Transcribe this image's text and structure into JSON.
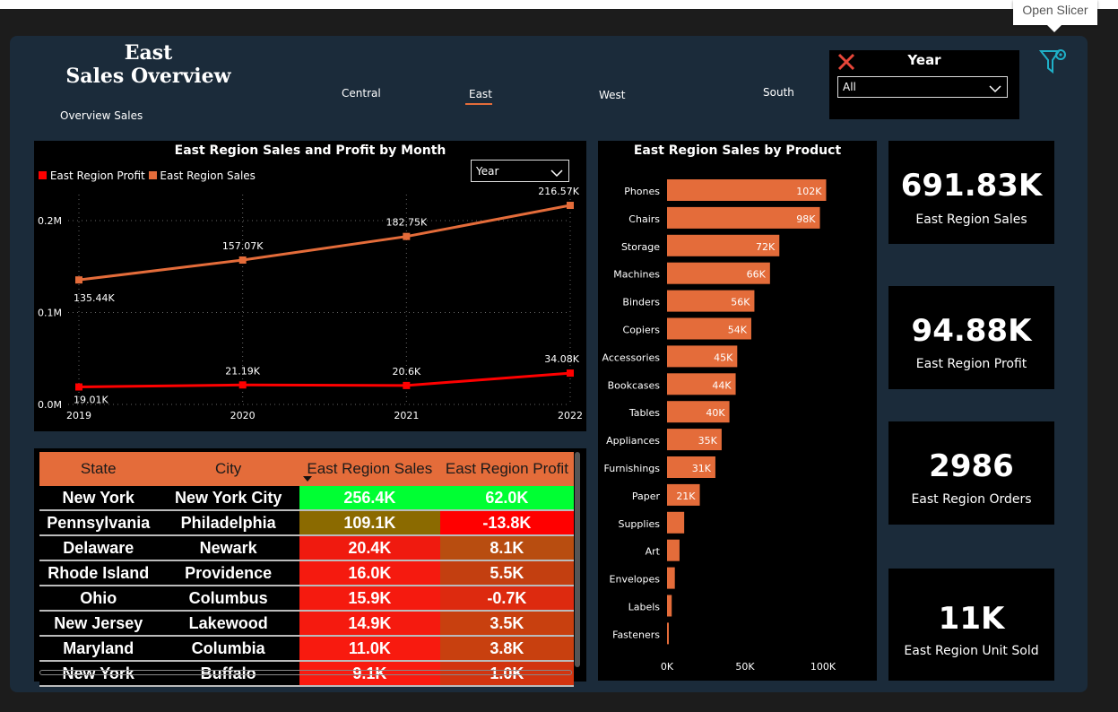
{
  "header": {
    "title_line1": "East",
    "title_line2": "Sales Overview",
    "subtitle": "Overview Sales"
  },
  "nav": {
    "items": [
      {
        "label": "Central"
      },
      {
        "label": "East",
        "active": true
      },
      {
        "label": "West"
      },
      {
        "label": "South"
      }
    ]
  },
  "year_filter": {
    "title": "Year",
    "value": "All"
  },
  "slicer_tooltip": "Open Slicer",
  "icons": {
    "clear": "close-icon",
    "slicer": "filter-gear-icon",
    "dropdown": "chevron-down-icon"
  },
  "colors": {
    "accent": "#e46c3a",
    "profit": "#ff0000",
    "panel": "#000000",
    "canvas": "#1b2b3a",
    "good": "#00ff33",
    "bad": "#ff0000"
  },
  "line_chart": {
    "title": "East Region Sales and Profit by Month",
    "legend": [
      "East Region Profit",
      "East Region Sales"
    ],
    "dropdown": "Year",
    "chart_data": {
      "type": "line",
      "x": [
        "2019",
        "2020",
        "2021",
        "2022"
      ],
      "yticks": [
        "0.0M",
        "0.1M",
        "0.2M"
      ],
      "ylim": [
        0,
        0.24
      ],
      "series": [
        {
          "name": "East Region Sales",
          "values": [
            0.13544,
            0.15707,
            0.18275,
            0.21657
          ],
          "labels": [
            "135.44K",
            "157.07K",
            "182.75K",
            "216.57K"
          ],
          "color": "#e46c3a"
        },
        {
          "name": "East Region Profit",
          "values": [
            0.01901,
            0.02119,
            0.0206,
            0.03408
          ],
          "labels": [
            "19.01K",
            "21.19K",
            "20.6K",
            "34.08K"
          ],
          "color": "#ff0000"
        }
      ]
    }
  },
  "bar_chart": {
    "title": "East Region Sales by Product",
    "chart_data": {
      "type": "bar",
      "orientation": "horizontal",
      "categories": [
        "Phones",
        "Chairs",
        "Storage",
        "Machines",
        "Binders",
        "Copiers",
        "Accessories",
        "Bookcases",
        "Tables",
        "Appliances",
        "Furnishings",
        "Paper",
        "Supplies",
        "Art",
        "Envelopes",
        "Labels",
        "Fasteners"
      ],
      "values": [
        102,
        98,
        72,
        66,
        56,
        54,
        45,
        44,
        40,
        35,
        31,
        21,
        11,
        8,
        5,
        3,
        1
      ],
      "labels": [
        "102K",
        "98K",
        "72K",
        "66K",
        "56K",
        "54K",
        "45K",
        "44K",
        "40K",
        "35K",
        "31K",
        "21K",
        "",
        "",
        "",
        "",
        ""
      ],
      "xticks": [
        "0K",
        "50K",
        "100K"
      ],
      "xlim": [
        0,
        100
      ],
      "color": "#e46c3a"
    }
  },
  "kpis": [
    {
      "value": "691.83K",
      "label": "East Region Sales"
    },
    {
      "value": "94.88K",
      "label": "East Region Profit"
    },
    {
      "value": "2986",
      "label": "East Region Orders"
    },
    {
      "value": "11K",
      "label": "East Region Unit Sold"
    }
  ],
  "table": {
    "columns": [
      "State",
      "City",
      "East Region Sales",
      "East Region Profit"
    ],
    "rows": [
      {
        "state": "New York",
        "city": "New York City",
        "sales": "256.4K",
        "profit": "62.0K",
        "sales_color": "#00ff33",
        "profit_color": "#00ff33"
      },
      {
        "state": "Pennsylvania",
        "city": "Philadelphia",
        "sales": "109.1K",
        "profit": "-13.8K",
        "sales_color": "#8b6a00",
        "profit_color": "#ff0000"
      },
      {
        "state": "Delaware",
        "city": "Newark",
        "sales": "20.4K",
        "profit": "8.1K",
        "sales_color": "#f01a0f",
        "profit_color": "#b84d10"
      },
      {
        "state": "Rhode Island",
        "city": "Providence",
        "sales": "16.0K",
        "profit": "5.5K",
        "sales_color": "#f51a0f",
        "profit_color": "#c33f10"
      },
      {
        "state": "Ohio",
        "city": "Columbus",
        "sales": "15.9K",
        "profit": "-0.7K",
        "sales_color": "#f51a0f",
        "profit_color": "#dd2a0f"
      },
      {
        "state": "New Jersey",
        "city": "Lakewood",
        "sales": "14.9K",
        "profit": "3.5K",
        "sales_color": "#f51a0f",
        "profit_color": "#c8400f"
      },
      {
        "state": "Maryland",
        "city": "Columbia",
        "sales": "11.0K",
        "profit": "3.8K",
        "sales_color": "#f81a0f",
        "profit_color": "#c8400f"
      },
      {
        "state": "New York",
        "city": "Buffalo",
        "sales": "9.1K",
        "profit": "1.0K",
        "sales_color": "#fa1a0f",
        "profit_color": "#d2340f"
      }
    ]
  }
}
